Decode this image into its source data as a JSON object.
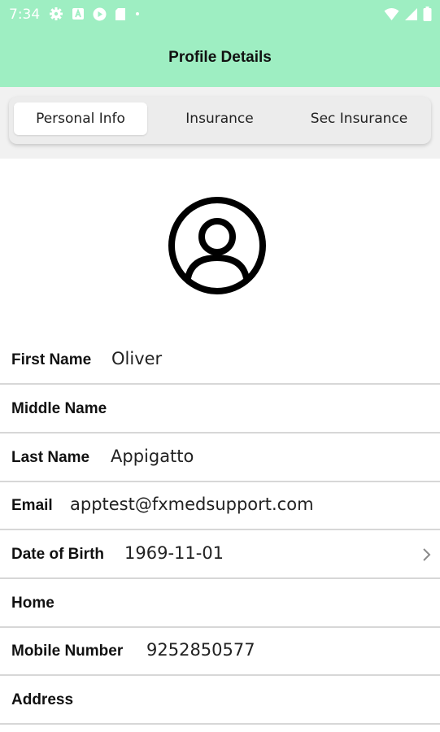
{
  "status_bar": {
    "time": "7:34",
    "left_icons": [
      "gear-icon",
      "a-icon",
      "play-icon",
      "sd-card-icon",
      "dot-icon"
    ],
    "right_icons": [
      "wifi-icon",
      "signal-icon",
      "battery-icon"
    ]
  },
  "header": {
    "title": "Profile Details",
    "background": "#9eeec2"
  },
  "tabs": [
    {
      "label": "Personal Info",
      "active": true
    },
    {
      "label": "Insurance",
      "active": false
    },
    {
      "label": "Sec Insurance",
      "active": false
    }
  ],
  "avatar": {
    "icon": "user-circle-icon"
  },
  "fields": [
    {
      "label": "First Name",
      "value": "Oliver"
    },
    {
      "label": "Middle Name",
      "value": ""
    },
    {
      "label": "Last Name",
      "value": "Appigatto"
    },
    {
      "label": "Email",
      "value": "apptest@fxmedsupport.com"
    },
    {
      "label": "Date of Birth",
      "value": "1969-11-01",
      "icon": "chevron-right-icon"
    },
    {
      "label": "Home",
      "value": ""
    },
    {
      "label": "Mobile Number",
      "value": "9252850577"
    },
    {
      "label": "Address",
      "value": ""
    }
  ]
}
